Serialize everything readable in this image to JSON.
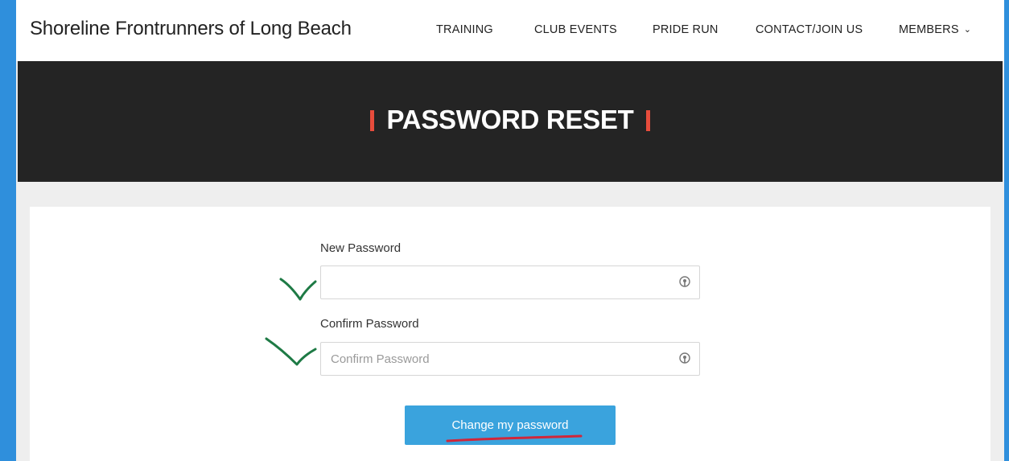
{
  "site": {
    "title": "Shoreline Frontrunners of Long Beach"
  },
  "nav": {
    "items": [
      {
        "label": "TRAINING"
      },
      {
        "label": "CLUB EVENTS"
      },
      {
        "label": "PRIDE RUN"
      },
      {
        "label": "CONTACT/JOIN US"
      },
      {
        "label": "MEMBERS",
        "dropdown": true,
        "icon": "chevron-down-icon"
      }
    ]
  },
  "page": {
    "title": "PASSWORD RESET",
    "accent_color": "#e74c3c"
  },
  "form": {
    "new_password": {
      "label": "New Password",
      "value": "",
      "placeholder": "",
      "icon": "key-icon"
    },
    "confirm_password": {
      "label": "Confirm Password",
      "value": "",
      "placeholder": "Confirm Password",
      "icon": "key-icon"
    },
    "submit_label": "Change my password",
    "button_color": "#3aa3dd"
  },
  "annotations": {
    "check_color": "#1e7a45",
    "underline_color": "#d0263a"
  }
}
